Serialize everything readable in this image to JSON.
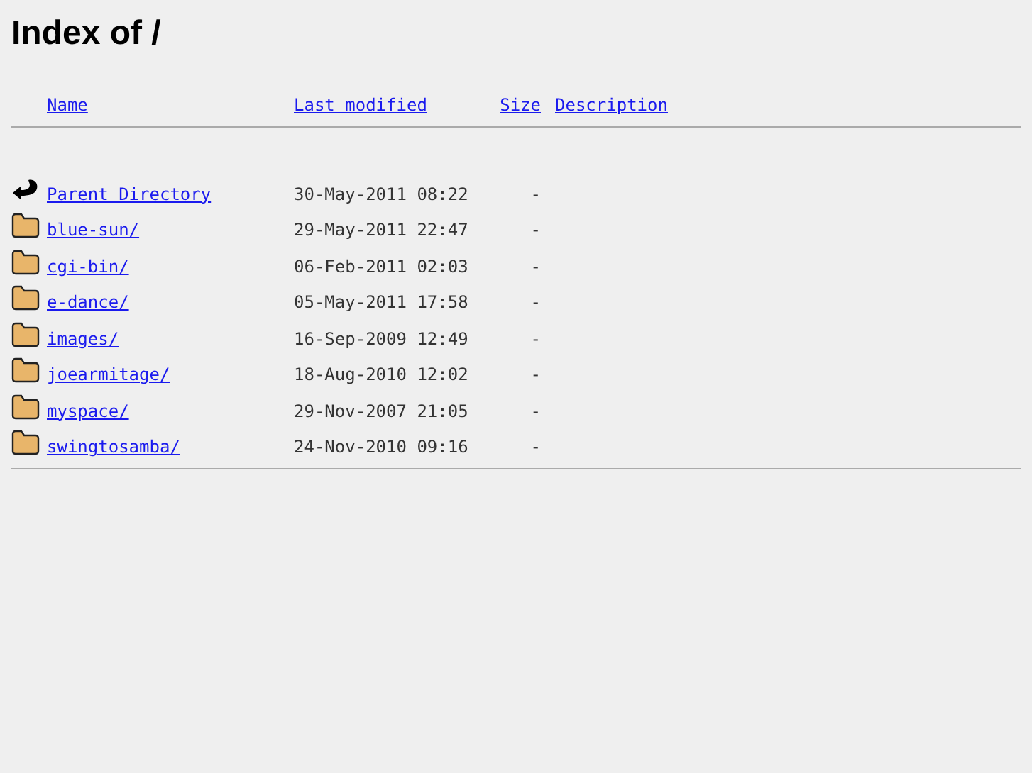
{
  "title": "Index of /",
  "columns": [
    "Name",
    "Last modified",
    "Size",
    "Description"
  ],
  "rows": [
    {
      "kind": "parent",
      "name": "Parent Directory",
      "modified": "30-May-2011 08:22",
      "size": "-"
    },
    {
      "kind": "folder",
      "name": "blue-sun/",
      "modified": "29-May-2011 22:47",
      "size": "-"
    },
    {
      "kind": "folder",
      "name": "cgi-bin/",
      "modified": "06-Feb-2011 02:03",
      "size": "-"
    },
    {
      "kind": "folder",
      "name": "e-dance/",
      "modified": "05-May-2011 17:58",
      "size": "-"
    },
    {
      "kind": "folder",
      "name": "images/",
      "modified": "16-Sep-2009 12:49",
      "size": "-"
    },
    {
      "kind": "folder",
      "name": "joearmitage/",
      "modified": "18-Aug-2010 12:02",
      "size": "-"
    },
    {
      "kind": "folder",
      "name": "myspace/",
      "modified": "29-Nov-2007 21:05",
      "size": "-"
    },
    {
      "kind": "folder",
      "name": "swingtosamba/",
      "modified": "24-Nov-2010 09:16",
      "size": "-"
    }
  ]
}
